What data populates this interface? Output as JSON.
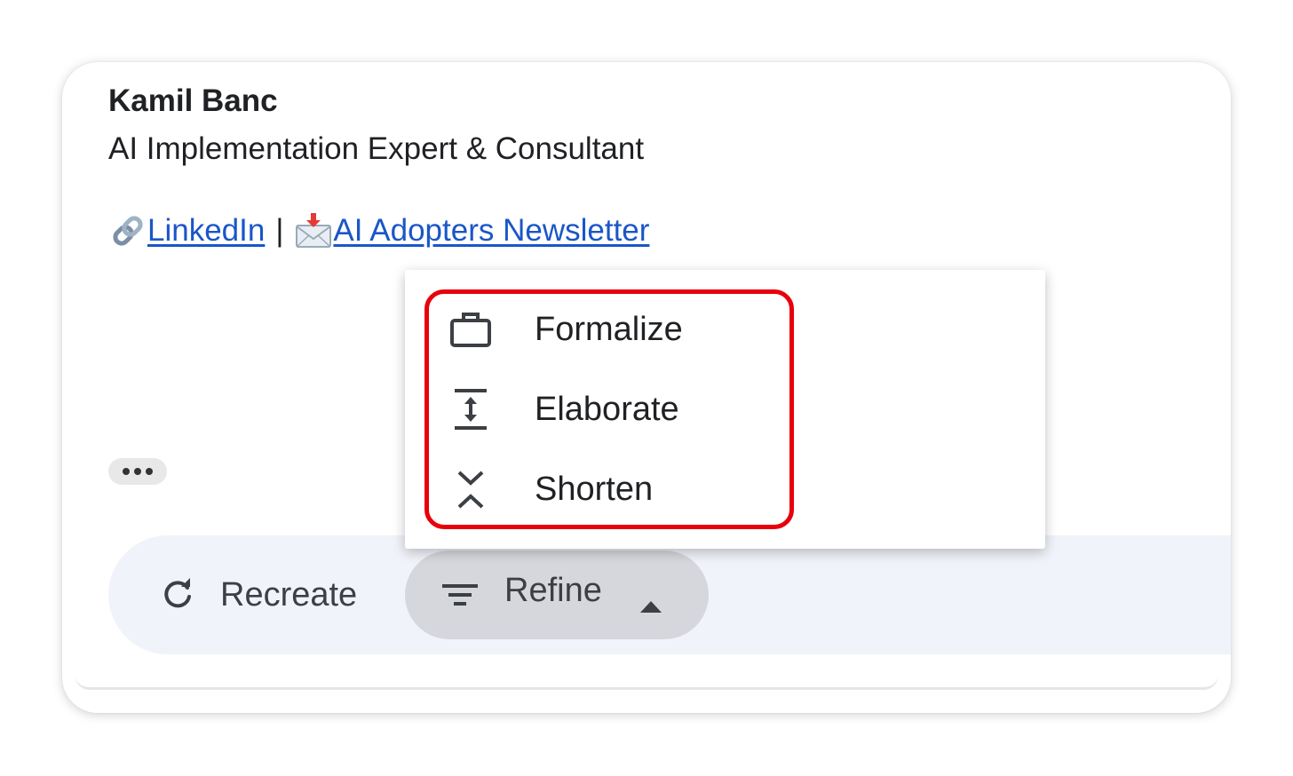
{
  "signature": {
    "name": "Kamil Banc",
    "title": "AI Implementation Expert & Consultant",
    "links": [
      {
        "icon": "link-icon",
        "label": "LinkedIn"
      },
      {
        "icon": "envelope-incoming-icon",
        "label": "AI Adopters Newsletter"
      }
    ],
    "separator": "|"
  },
  "actions": {
    "recreate_label": "Recreate",
    "refine_label": "Refine"
  },
  "refine_menu": {
    "items": [
      {
        "icon": "briefcase-icon",
        "label": "Formalize"
      },
      {
        "icon": "expand-vertical-icon",
        "label": "Elaborate"
      },
      {
        "icon": "collapse-vertical-icon",
        "label": "Shorten"
      }
    ]
  },
  "colors": {
    "link": "#1a56c8",
    "highlight": "#e8000b",
    "action_bar": "#f1f3fa",
    "refine_active": "#d6d7dc"
  }
}
